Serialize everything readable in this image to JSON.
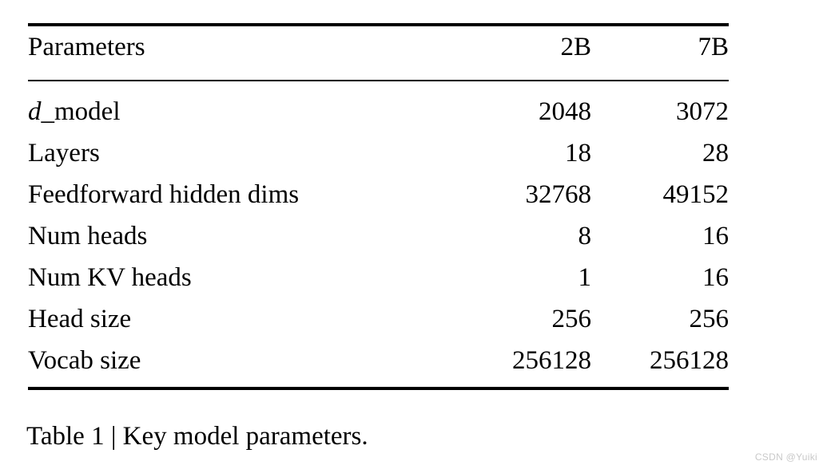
{
  "figure": {
    "caption_prefix": "Table 1",
    "caption_separator": "|",
    "caption_text": "Key model parameters.",
    "caption_full": "Table 1 | Key model parameters."
  },
  "watermark": {
    "text": "CSDN @Yuiki",
    "color": "#c9c9c9"
  },
  "colors": {
    "background": "#ffffff",
    "text": "#000000",
    "rule": "#000000"
  },
  "chart_data": {
    "type": "table",
    "title": "Table 1 | Key model parameters.",
    "columns": [
      "Parameters",
      "2B",
      "7B"
    ],
    "rows": [
      {
        "parameter": "d_model",
        "parameter_italic_prefix": "d",
        "parameter_rest": "_model",
        "2B": "2048",
        "7B": "3072"
      },
      {
        "parameter": "Layers",
        "2B": "18",
        "7B": "28"
      },
      {
        "parameter": "Feedforward hidden dims",
        "2B": "32768",
        "7B": "49152"
      },
      {
        "parameter": "Num heads",
        "2B": "8",
        "7B": "16"
      },
      {
        "parameter": "Num KV heads",
        "2B": "1",
        "7B": "16"
      },
      {
        "parameter": "Head size",
        "2B": "256",
        "7B": "256"
      },
      {
        "parameter": "Vocab size",
        "2B": "256128",
        "7B": "256128"
      }
    ]
  },
  "table": {
    "header": {
      "col_parameters": "Parameters",
      "col_2b": "2B",
      "col_7b": "7B"
    },
    "rows": [
      {
        "label_italic": "d",
        "label_rest": "_model",
        "v2b": "2048",
        "v7b": "3072"
      },
      {
        "label": "Layers",
        "v2b": "18",
        "v7b": "28"
      },
      {
        "label": "Feedforward hidden dims",
        "v2b": "32768",
        "v7b": "49152"
      },
      {
        "label": "Num heads",
        "v2b": "8",
        "v7b": "16"
      },
      {
        "label": "Num KV heads",
        "v2b": "1",
        "v7b": "16"
      },
      {
        "label": "Head size",
        "v2b": "256",
        "v7b": "256"
      },
      {
        "label": "Vocab size",
        "v2b": "256128",
        "v7b": "256128"
      }
    ]
  }
}
